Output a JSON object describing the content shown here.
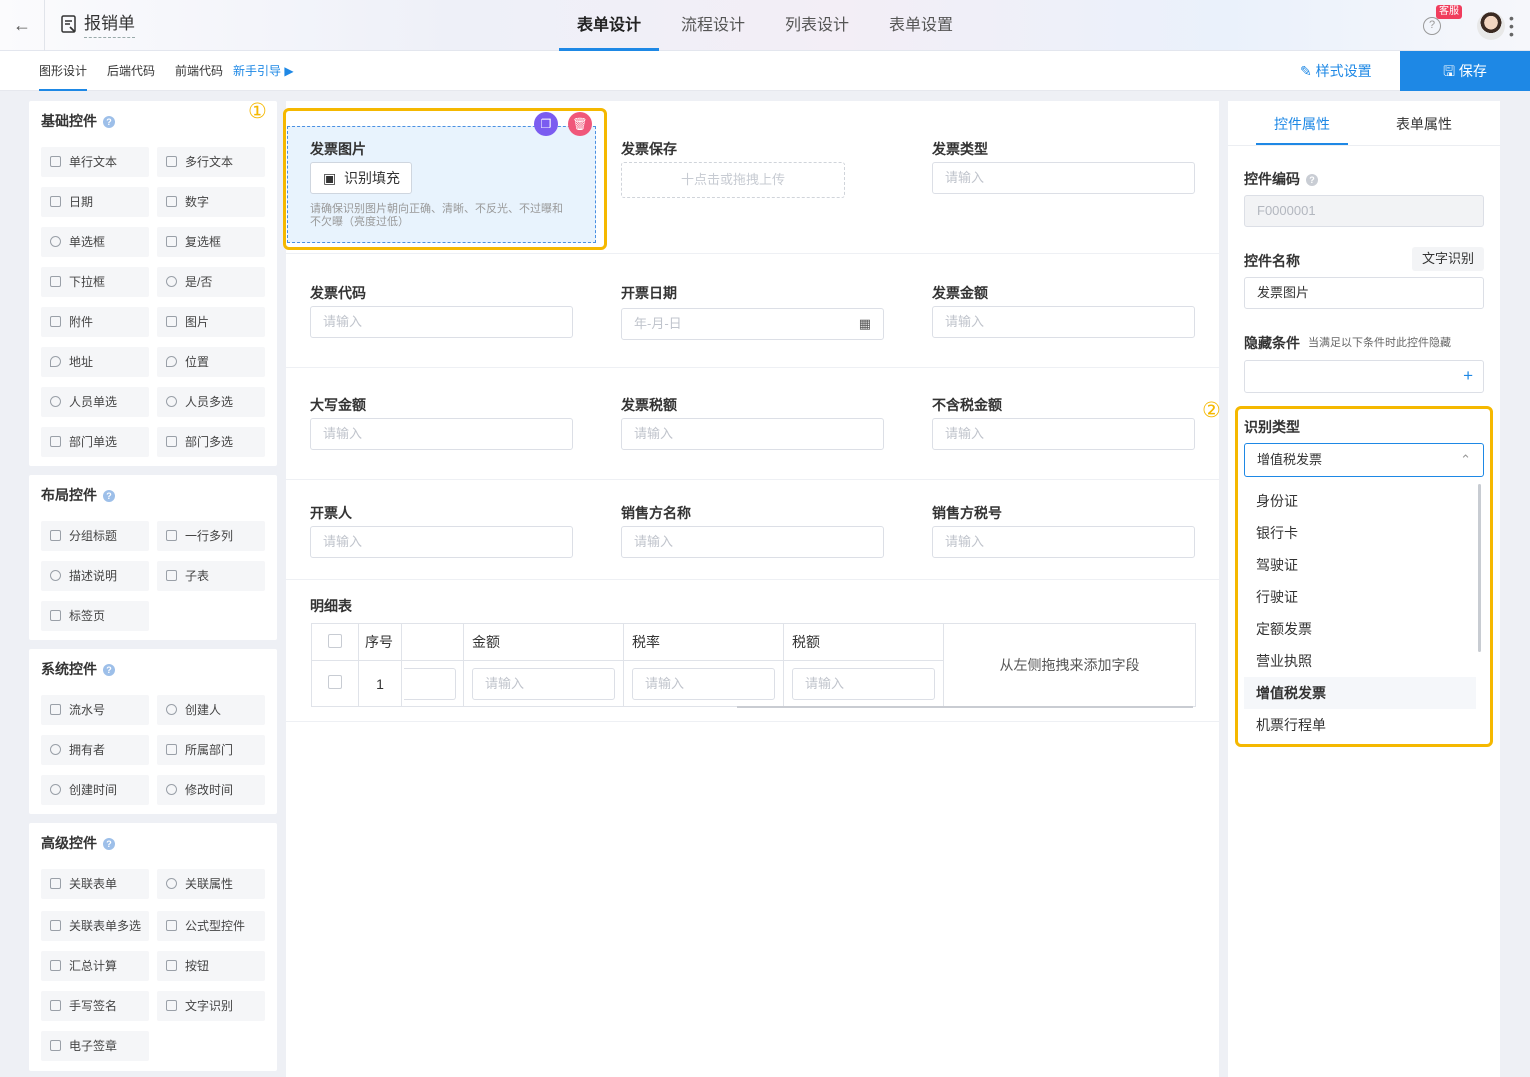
{
  "header": {
    "title": "报销单",
    "tabs": [
      "表单设计",
      "流程设计",
      "列表设计",
      "表单设置"
    ],
    "active_tab": "表单设计",
    "badge": "客服"
  },
  "subbar": {
    "tabs": [
      "图形设计",
      "后端代码",
      "前端代码"
    ],
    "guide": "新手引导",
    "style_settings": "样式设置",
    "save": "保存"
  },
  "palette": {
    "basic": {
      "title": "基础控件",
      "items": [
        "单行文本",
        "多行文本",
        "日期",
        "数字",
        "单选框",
        "复选框",
        "下拉框",
        "是/否",
        "附件",
        "图片",
        "地址",
        "位置",
        "人员单选",
        "人员多选",
        "部门单选",
        "部门多选"
      ]
    },
    "layout": {
      "title": "布局控件",
      "items": [
        "分组标题",
        "一行多列",
        "描述说明",
        "子表",
        "标签页"
      ]
    },
    "system": {
      "title": "系统控件",
      "items": [
        "流水号",
        "创建人",
        "拥有者",
        "所属部门",
        "创建时间",
        "修改时间"
      ]
    },
    "advanced": {
      "title": "高级控件",
      "items": [
        "关联表单",
        "关联属性",
        "关联表单多选",
        "公式型控件",
        "汇总计算",
        "按钮",
        "手写签名",
        "文字识别",
        "电子签章"
      ]
    }
  },
  "form": {
    "selected_field": {
      "label": "发票图片",
      "button": "识别填充",
      "hint": "请确保识别图片朝向正确、清晰、不反光、不过曝和不欠曝（亮度过低）"
    },
    "badge_1": "①",
    "badge_2": "②",
    "upload_label": "发票保存",
    "upload_placeholder": "十点击或拖拽上传",
    "type_label": "发票类型",
    "placeholder": "请输入",
    "date_placeholder": "年-月-日",
    "row2": [
      "发票代码",
      "开票日期",
      "发票金额"
    ],
    "row3": [
      "大写金额",
      "发票税额",
      "不含税金额"
    ],
    "row4": [
      "开票人",
      "销售方名称",
      "销售方税号"
    ],
    "detail": {
      "title": "明细表",
      "headers": [
        "序号",
        "金额",
        "税率",
        "税额"
      ],
      "row_index": "1",
      "drag_hint": "从左侧拖拽来添加字段"
    }
  },
  "props": {
    "tabs": [
      "控件属性",
      "表单属性"
    ],
    "code_label": "控件编码",
    "code_value": "F0000001",
    "name_label": "控件名称",
    "ocr_tag": "文字识别",
    "name_value": "发票图片",
    "hidden_label": "隐藏条件",
    "hidden_desc": "当满足以下条件时此控件隐藏",
    "recog_label": "识别类型",
    "recog_value": "增值税发票",
    "options": [
      "身份证",
      "银行卡",
      "驾驶证",
      "行驶证",
      "定额发票",
      "营业执照",
      "增值税发票",
      "机票行程单"
    ],
    "selected_option": "增值税发票"
  }
}
